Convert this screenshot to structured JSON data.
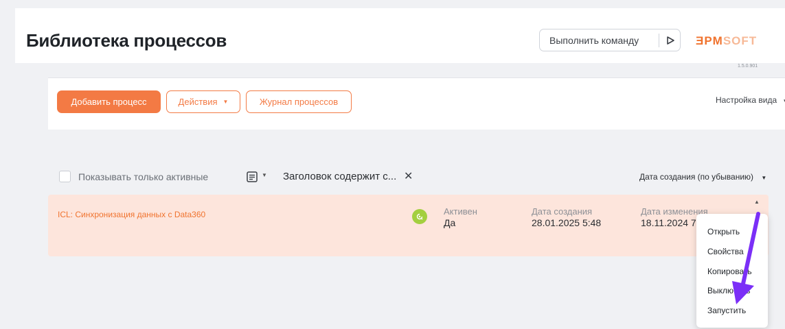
{
  "header": {
    "title": "Библиотека процессов",
    "command_label": "Выполнить команду",
    "run_icon": "play-icon",
    "logo_main": "ƎPM",
    "logo_soft": "SOFT",
    "version": "1.5.0.901"
  },
  "toolbar": {
    "add_label": "Добавить процесс",
    "actions_label": "Действия",
    "log_label": "Журнал процессов",
    "view_settings_label": "Настройка вида"
  },
  "filters": {
    "only_active_label": "Показывать только активные",
    "filter_tag": "Заголовок содержит с...",
    "sort_label": "Дата создания (по убыванию)"
  },
  "record": {
    "title": "ICL: Синхронизация данных с Data360",
    "active_label": "Активен",
    "active_value": "Да",
    "created_label": "Дата создания",
    "created_value": "28.01.2025 5:48",
    "modified_label": "Дата изменения",
    "modified_value": "18.11.2024 7:01"
  },
  "menu": {
    "items": [
      "Открыть",
      "Свойства",
      "Копировать",
      "Выключить",
      "Запустить"
    ]
  },
  "colors": {
    "accent": "#f37a44",
    "record_bg": "#fde5dc",
    "active_icon": "#a3cf3f",
    "arrow": "#7b2ff7"
  }
}
